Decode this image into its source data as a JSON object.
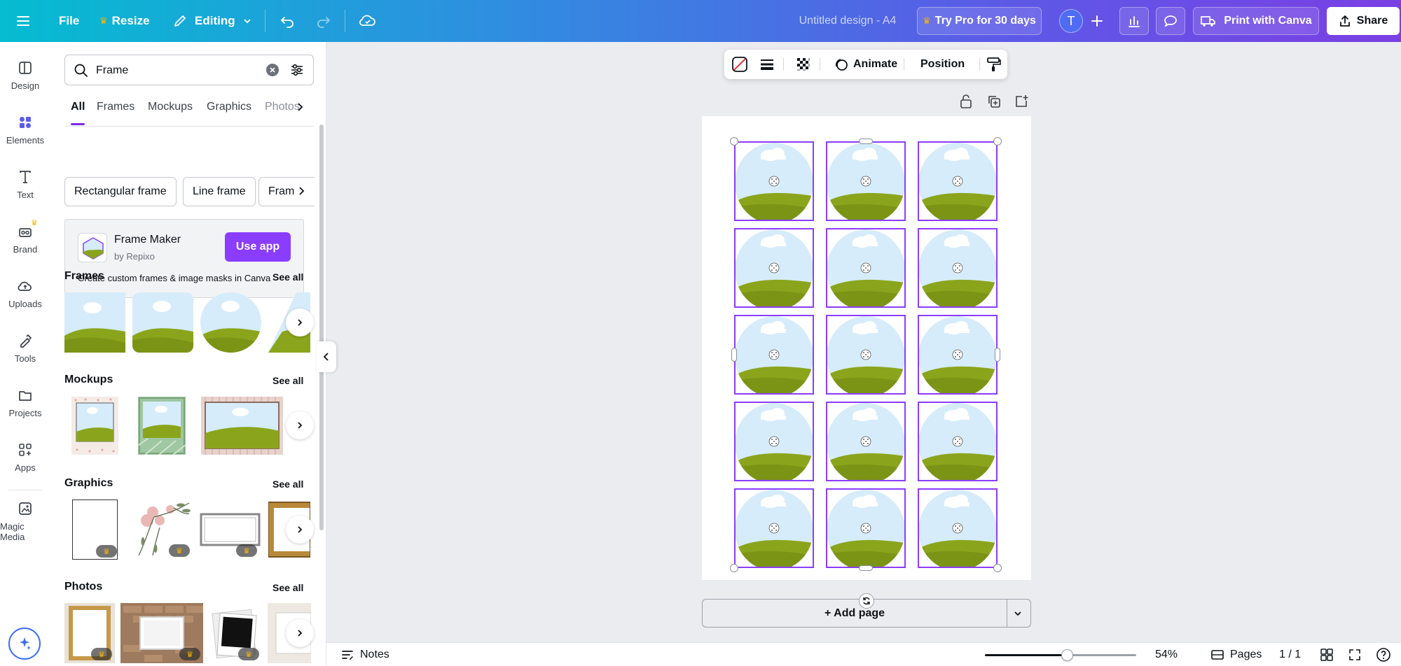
{
  "topbar": {
    "file_label": "File",
    "resize_label": "Resize",
    "editing_label": "Editing",
    "title": "Untitled design - A4",
    "try_pro_label": "Try Pro for 30 days",
    "avatar_initial": "T",
    "print_label": "Print with Canva",
    "share_label": "Share",
    "brand_gradient": [
      "#05bcd0",
      "#7b3fe4"
    ]
  },
  "rail": {
    "items": [
      {
        "label": "Design",
        "icon": "design-icon"
      },
      {
        "label": "Elements",
        "icon": "elements-icon",
        "active": true
      },
      {
        "label": "Text",
        "icon": "text-icon"
      },
      {
        "label": "Brand",
        "icon": "brand-icon"
      },
      {
        "label": "Uploads",
        "icon": "uploads-icon"
      },
      {
        "label": "Tools",
        "icon": "tools-icon"
      },
      {
        "label": "Projects",
        "icon": "projects-icon"
      },
      {
        "label": "Apps",
        "icon": "apps-icon"
      },
      {
        "label": "Magic Media",
        "icon": "magic-media-icon"
      }
    ]
  },
  "panel": {
    "search_value": "Frame",
    "tabs": [
      "All",
      "Frames",
      "Mockups",
      "Graphics",
      "Photos"
    ],
    "active_tab": "All",
    "chips": [
      "Rectangular frame",
      "Line frame",
      "Fram"
    ],
    "promo": {
      "app_name": "Frame Maker",
      "app_by": "by Repixo",
      "cta": "Use app",
      "description": "Create custom frames & image masks in Canva"
    },
    "sections": {
      "frames": {
        "title": "Frames",
        "see_all": "See all"
      },
      "mockups": {
        "title": "Mockups",
        "see_all": "See all"
      },
      "graphics": {
        "title": "Graphics",
        "see_all": "See all"
      },
      "photos": {
        "title": "Photos",
        "see_all": "See all"
      }
    }
  },
  "float_toolbar": {
    "animate_label": "Animate",
    "position_label": "Position"
  },
  "canvas": {
    "rows": 5,
    "cols": 3,
    "frame_shape": "circle",
    "selection_color": "#8b3dff",
    "add_page_label": "+ Add page"
  },
  "bottombar": {
    "notes_label": "Notes",
    "zoom_label": "54%",
    "zoom_fraction": 0.54,
    "pages_label": "Pages",
    "page_count": "1 / 1"
  },
  "colors": {
    "accent": "#8b3dff",
    "sky": "#d6ecfa",
    "grass": "#8aa51c"
  }
}
